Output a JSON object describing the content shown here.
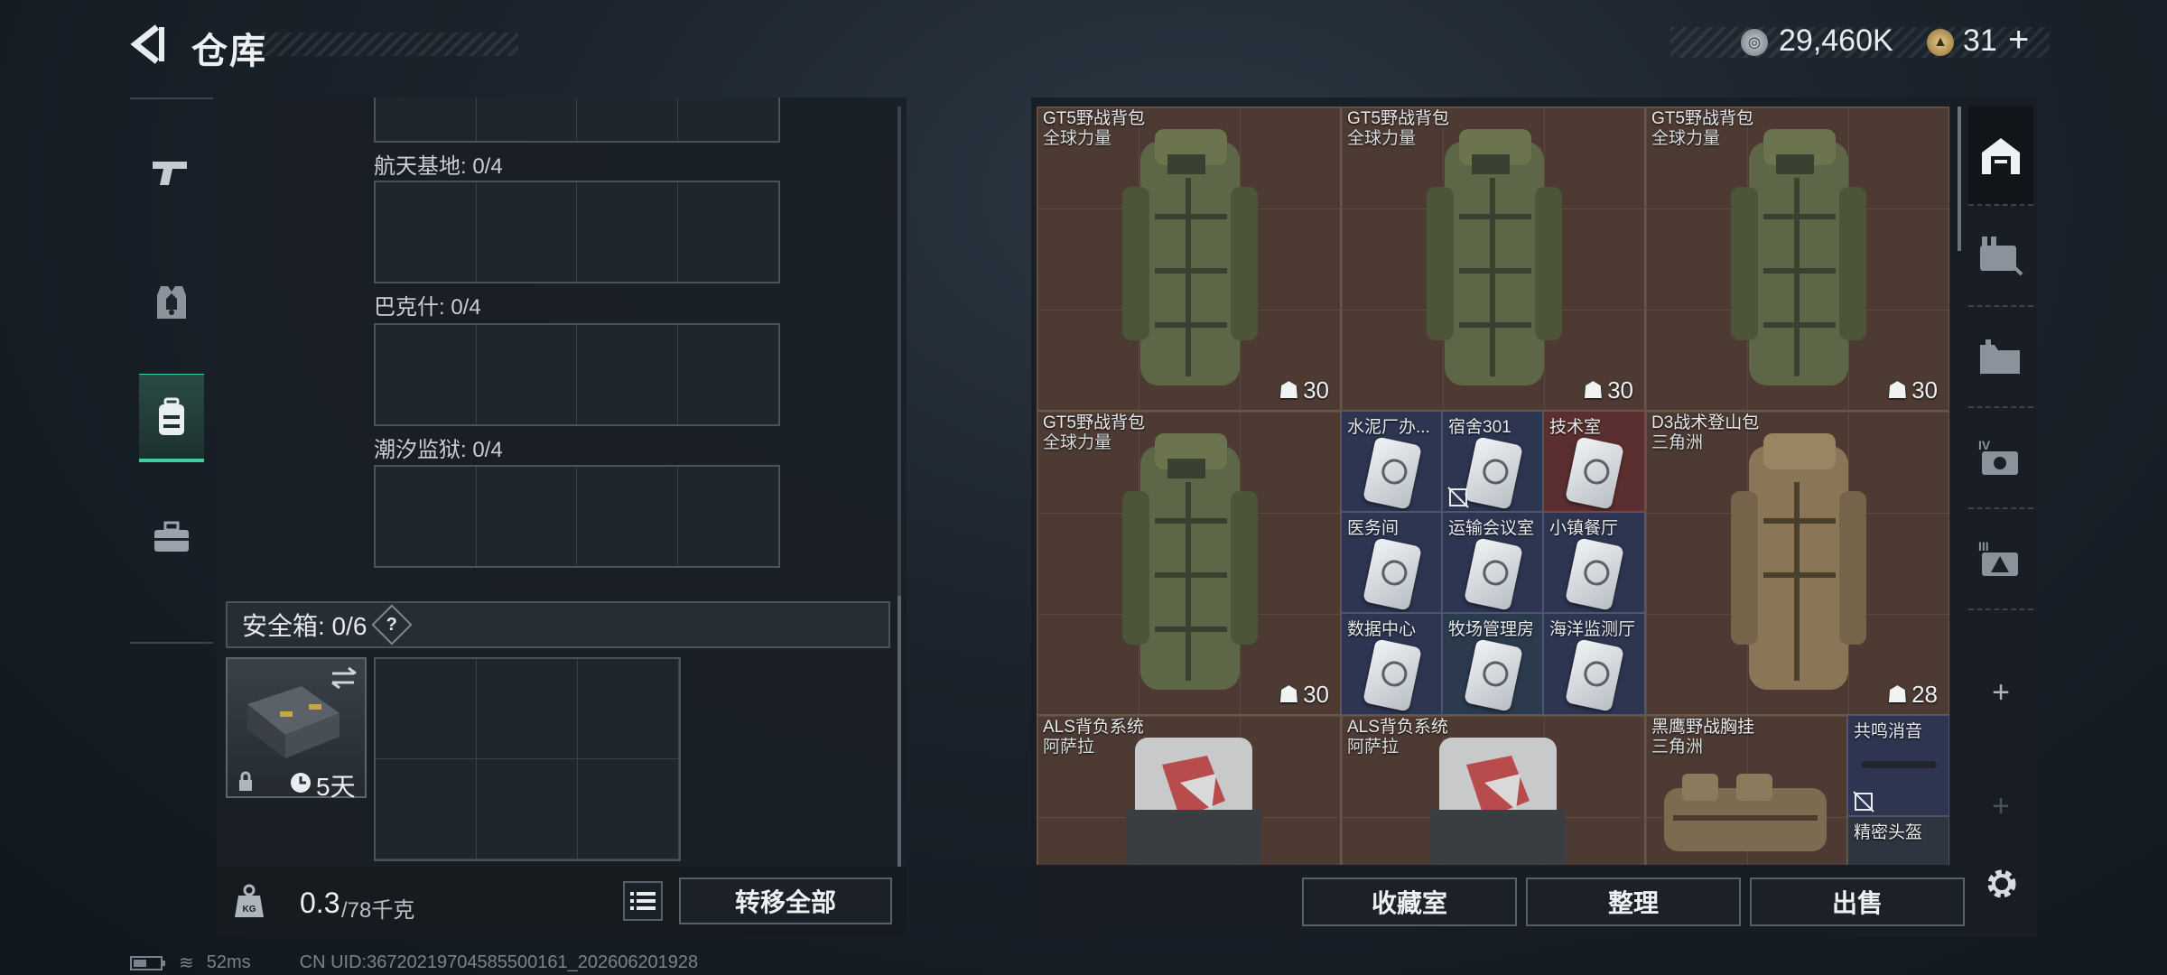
{
  "header": {
    "title": "仓库",
    "currency_primary": "29,460K",
    "currency_secondary": "31",
    "add_label": "+"
  },
  "sidebar": {
    "items": [
      {
        "name": "weapons",
        "icon": "pistol-icon",
        "active": false
      },
      {
        "name": "equipment",
        "icon": "armor-vest-icon",
        "active": false
      },
      {
        "name": "backpacks",
        "icon": "backpack-icon",
        "active": true
      },
      {
        "name": "supplies",
        "icon": "toolbox-icon",
        "active": false
      }
    ]
  },
  "left_panel": {
    "regions": [
      {
        "label": "航天基地: 0/4"
      },
      {
        "label": "巴克什: 0/4"
      },
      {
        "label": "潮汐监狱: 0/4"
      }
    ],
    "safe_box": {
      "label": "安全箱: 0/6",
      "help": "?",
      "duration": "5天"
    },
    "weight_value": "0.3",
    "weight_total": "/78千克",
    "transfer_all_label": "转移全部"
  },
  "right_panel": {
    "items": [
      {
        "name": "GT5野战背包",
        "tag": "全球力量",
        "capacity": "30"
      },
      {
        "name": "GT5野战背包",
        "tag": "全球力量",
        "capacity": "30"
      },
      {
        "name": "GT5野战背包",
        "tag": "全球力量",
        "capacity": "30"
      },
      {
        "name": "GT5野战背包",
        "tag": "全球力量",
        "capacity": "30"
      },
      {
        "name": "D3战术登山包",
        "tag": "三角洲",
        "capacity": "28"
      },
      {
        "name": "ALS背负系统",
        "tag": "阿萨拉"
      },
      {
        "name": "ALS背负系统",
        "tag": "阿萨拉"
      },
      {
        "name": "黑鹰野战胸挂",
        "tag": "三角洲"
      }
    ],
    "keys": [
      "水泥厂办...",
      "宿舍301",
      "技术室",
      "医务间",
      "运输会议室",
      "小镇餐厅",
      "数据中心",
      "牧场管理房",
      "海洋监测厅"
    ],
    "small_items": [
      "共鸣消音",
      "精密头盔"
    ],
    "buttons": {
      "collection": "收藏室",
      "organize": "整理",
      "sell": "出售"
    }
  },
  "status_bar": {
    "ping": "52ms",
    "uid": "CN UID:3672021970458550016​1_202606201928"
  },
  "colors": {
    "accent": "#3ecf9a",
    "item_bg": "#4d3b33",
    "key_bg": "#2d3550"
  }
}
